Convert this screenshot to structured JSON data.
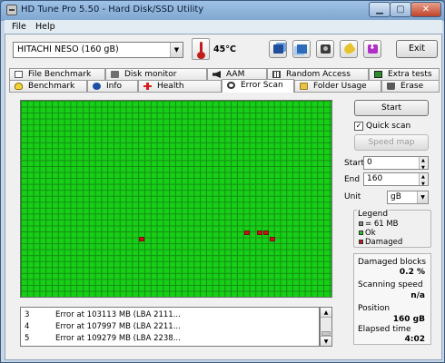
{
  "window": {
    "title": "HD Tune Pro 5.50 - Hard Disk/SSD Utility",
    "controls": {
      "minimize": "▁",
      "maximize": "▢",
      "close": "✕"
    }
  },
  "menu": {
    "file": "File",
    "help": "Help"
  },
  "toolbar": {
    "drive": "HITACHI NESO (160 gB)",
    "temperature": "45°C",
    "exit": "Exit",
    "icons": [
      "copy-text-icon",
      "copy-info-icon",
      "screenshot-icon",
      "options-key-icon",
      "save-download-icon"
    ]
  },
  "tabs": {
    "top": [
      "File Benchmark",
      "Disk monitor",
      "AAM",
      "Random Access",
      "Extra tests"
    ],
    "bottom": [
      "Benchmark",
      "Info",
      "Health",
      "Error Scan",
      "Folder Usage",
      "Erase"
    ],
    "active": "Error Scan"
  },
  "scan_map": {
    "grid_color": "#138c13",
    "ok_color": "#17cf17",
    "damaged_color": "#c41616",
    "damaged_blocks_shown": 5
  },
  "errors": [
    {
      "num": "3",
      "msg": "Error at 103113 MB (LBA 2111..."
    },
    {
      "num": "4",
      "msg": "Error at 107997 MB (LBA 2211..."
    },
    {
      "num": "5",
      "msg": "Error at 109279 MB (LBA 2238..."
    }
  ],
  "controls": {
    "start_button": "Start",
    "quick_scan_label": "Quick scan",
    "quick_scan_checked": true,
    "speed_map_button": "Speed map",
    "start_label": "Start",
    "start_value": "0",
    "end_label": "End",
    "end_value": "160",
    "unit_label": "Unit",
    "unit_value": "gB"
  },
  "legend": {
    "title": "Legend",
    "block_size": "= 61 MB",
    "ok": "Ok",
    "damaged": "Damaged"
  },
  "stats": {
    "damaged_blocks_label": "Damaged blocks",
    "damaged_blocks_value": "0.2 %",
    "scanning_speed_label": "Scanning speed",
    "scanning_speed_value": "n/a",
    "position_label": "Position",
    "position_value": "160 gB",
    "elapsed_label": "Elapsed time",
    "elapsed_value": "4:02"
  }
}
